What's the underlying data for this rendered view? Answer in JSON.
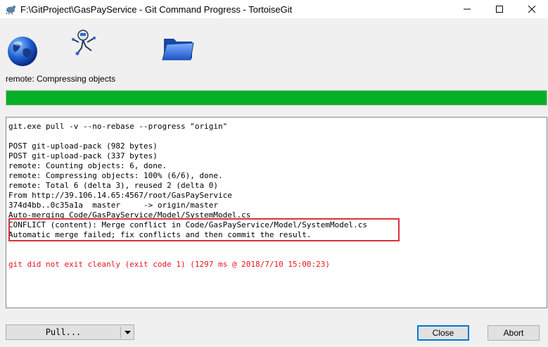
{
  "window": {
    "title": "F:\\GitProject\\GasPayService - Git Command Progress - TortoiseGit",
    "controls": [
      "minimize",
      "maximize",
      "close"
    ]
  },
  "icons": [
    "globe-icon",
    "robot-icon",
    "folder-icon"
  ],
  "status": {
    "text": "remote: Compressing objects",
    "progress_percent": 100,
    "progress_color": "#06b025"
  },
  "log": {
    "lines": [
      {
        "text": "git.exe pull -v --no-rebase --progress \"origin\"",
        "type": "normal"
      },
      {
        "text": "",
        "type": "normal"
      },
      {
        "text": "POST git-upload-pack (982 bytes)",
        "type": "normal"
      },
      {
        "text": "POST git-upload-pack (337 bytes)",
        "type": "normal"
      },
      {
        "text": "remote: Counting objects: 6, done.",
        "type": "normal"
      },
      {
        "text": "remote: Compressing objects: 100% (6/6), done.",
        "type": "normal"
      },
      {
        "text": "remote: Total 6 (delta 3), reused 2 (delta 0)",
        "type": "normal"
      },
      {
        "text": "From http://39.106.14.65:4567/root/GasPayService",
        "type": "normal"
      },
      {
        "text": "374d4bb..0c35a1a  master     -> origin/master",
        "type": "normal"
      },
      {
        "text": "Auto-merging Code/GasPayService/Model/SystemModel.cs",
        "type": "normal"
      },
      {
        "text": "CONFLICT (content): Merge conflict in Code/GasPayService/Model/SystemModel.cs",
        "type": "normal"
      },
      {
        "text": "Automatic merge failed; fix conflicts and then commit the result.",
        "type": "normal"
      },
      {
        "text": "",
        "type": "normal"
      },
      {
        "text": "",
        "type": "normal"
      },
      {
        "text": "git did not exit cleanly (exit code 1) (1297 ms @ 2018/7/10 15:00:23)",
        "type": "err"
      }
    ],
    "error_color": "#e8141c",
    "highlight_color": "#d9313a"
  },
  "buttons": {
    "pull_label": "Pull...",
    "close_label": "Close",
    "abort_label": "Abort"
  }
}
